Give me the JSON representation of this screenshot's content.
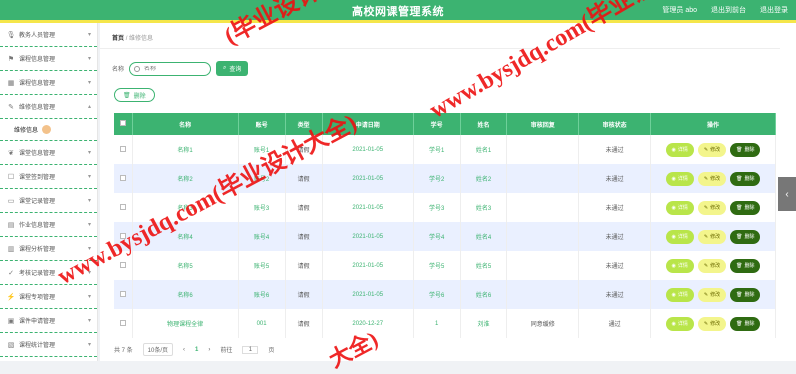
{
  "header": {
    "title": "高校网课管理系统",
    "user": "管理员 abo",
    "back": "退出到前台",
    "logout": "退出登录"
  },
  "sidebar": {
    "items": [
      {
        "label": "教务人员管理",
        "icon": "mic-icon"
      },
      {
        "label": "课程信息管理",
        "icon": "flag-icon"
      },
      {
        "label": "课程信息管理",
        "icon": "grid-icon"
      },
      {
        "label": "维修信息管理",
        "icon": "wrench-icon",
        "expanded": true,
        "sub": [
          "维修信息"
        ]
      },
      {
        "label": "课堂信息管理",
        "icon": "leaf-icon"
      },
      {
        "label": "课堂签到管理",
        "icon": "checkin-icon"
      },
      {
        "label": "课堂记录管理",
        "icon": "file-icon"
      },
      {
        "label": "作业信息管理",
        "icon": "book-icon"
      },
      {
        "label": "课程分析管理",
        "icon": "chart-icon"
      },
      {
        "label": "考核记录管理",
        "icon": "exam-icon"
      },
      {
        "label": "课程专项管理",
        "icon": "bolt-icon"
      },
      {
        "label": "课件申请管理",
        "icon": "doc-icon"
      },
      {
        "label": "课程统计管理",
        "icon": "stat-icon"
      }
    ]
  },
  "breadcrumb": {
    "home": "首页",
    "sep": "/",
    "current": "维修信息"
  },
  "search": {
    "label": "名称",
    "placeholder": "名称",
    "query_btn": "查询"
  },
  "toolbar": {
    "delete_btn": "删除"
  },
  "table": {
    "headers": [
      "名称",
      "账号",
      "类型",
      "申请日期",
      "学号",
      "姓名",
      "审核回复",
      "审核状态",
      "操作"
    ],
    "rows": [
      [
        "名称1",
        "账号1",
        "请假",
        "2021-01-05",
        "学号1",
        "姓名1",
        "",
        "未通过"
      ],
      [
        "名称2",
        "账号2",
        "请假",
        "2021-01-05",
        "学号2",
        "姓名2",
        "",
        "未通过"
      ],
      [
        "名称3",
        "账号3",
        "请假",
        "2021-01-05",
        "学号3",
        "姓名3",
        "",
        "未通过"
      ],
      [
        "名称4",
        "账号4",
        "请假",
        "2021-01-05",
        "学号4",
        "姓名4",
        "",
        "未通过"
      ],
      [
        "名称5",
        "账号5",
        "请假",
        "2021-01-05",
        "学号5",
        "姓名5",
        "",
        "未通过"
      ],
      [
        "名称6",
        "账号6",
        "请假",
        "2021-01-05",
        "学号6",
        "姓名6",
        "",
        "未通过"
      ],
      [
        "物理课程全律",
        "001",
        "请假",
        "2020-12-27",
        "1",
        "刘淮",
        "同意缓修",
        "通过"
      ]
    ],
    "actions": {
      "detail": "详情",
      "edit": "修改",
      "delete": "删除"
    }
  },
  "pager": {
    "total": "共 7 条",
    "size": "10条/页",
    "prev": "‹",
    "page": "1",
    "next": "›",
    "goto": "前往",
    "page_input": "1",
    "unit": "页"
  },
  "watermark": {
    "text1": "(毕业设计大全)",
    "text2": "www.bysjdq.com(毕业设计",
    "text3": "www.bysjdq.com(毕业设计大全)",
    "text4": "大全)"
  },
  "colors": {
    "primary": "#3cb371",
    "accent_line": "#f5e64a",
    "watermark": "#e11111"
  }
}
